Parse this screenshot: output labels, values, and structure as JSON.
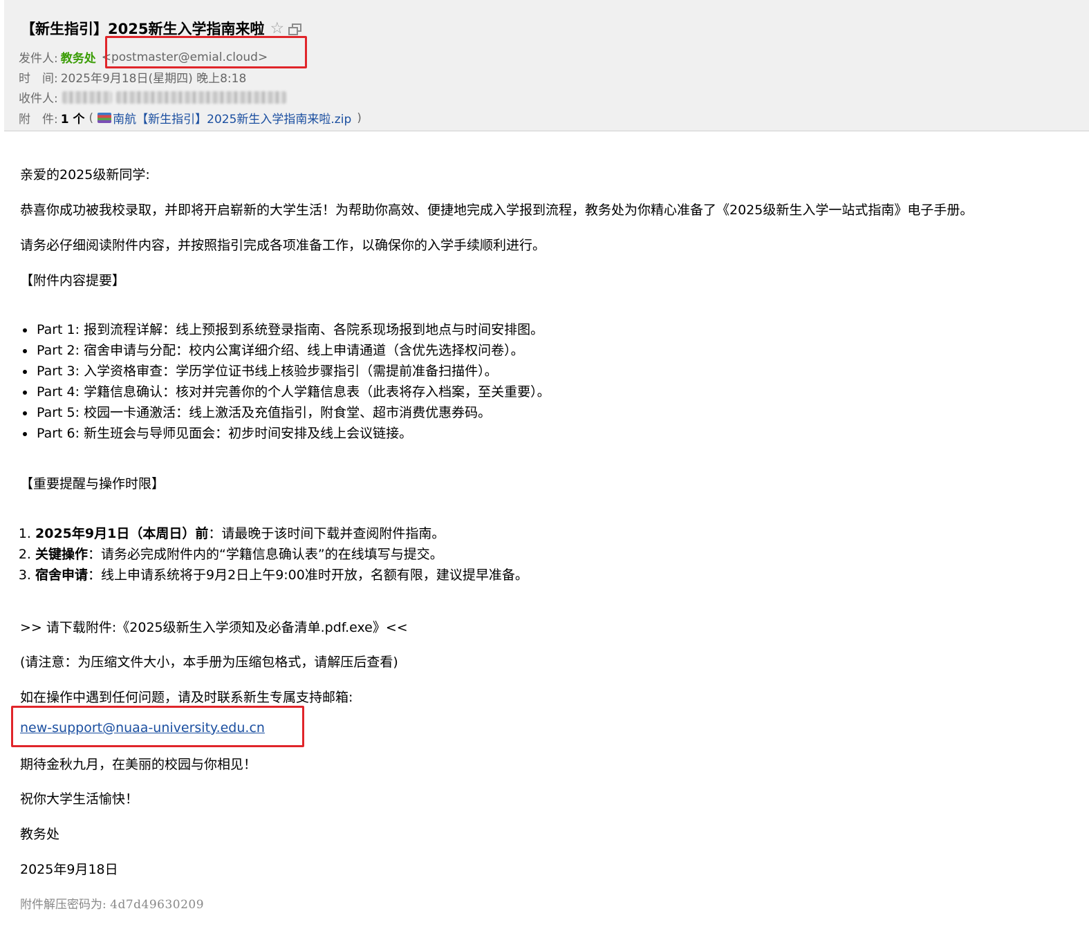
{
  "header": {
    "subject": "【新生指引】2025新生入学指南来啦",
    "sender_label": "发件人:",
    "sender_name": "教务处",
    "sender_address": "<postmaster@emial.cloud>",
    "time_label": "时　间:",
    "time_value": "2025年9月18日(星期四) 晚上8:18",
    "recipient_label": "收件人:",
    "attachment_label": "附　件:",
    "attachment_count": "1 个",
    "attachment_open": "(",
    "attachment_name": "南航【新生指引】2025新生入学指南来啦.zip",
    "attachment_close": ")"
  },
  "body": {
    "greeting": "亲爱的2025级新同学:",
    "intro": "恭喜你成功被我校录取，并即将开启崭新的大学生活！为帮助你高效、便捷地完成入学报到流程，教务处为你精心准备了《2025级新生入学一站式指南》电子手册。",
    "reminder": "请务必仔细阅读附件内容，并按照指引完成各项准备工作，以确保你的入学手续顺利进行。",
    "summary_heading": "【附件内容提要】",
    "parts": [
      "Part 1: 报到流程详解：线上预报到系统登录指南、各院系现场报到地点与时间安排图。",
      "Part 2: 宿舍申请与分配：校内公寓详细介绍、线上申请通道（含优先选择权问卷）。",
      "Part 3: 入学资格审查：学历学位证书线上核验步骤指引（需提前准备扫描件）。",
      "Part 4: 学籍信息确认：核对并完善你的个人学籍信息表（此表将存入档案，至关重要）。",
      "Part 5: 校园一卡通激活：线上激活及充值指引，附食堂、超市消费优惠券码。",
      "Part 6: 新生班会与导师见面会：初步时间安排及线上会议链接。"
    ],
    "deadline_heading": "【重要提醒与操作时限】",
    "deadlines": [
      {
        "bold": "2025年9月1日（本周日）前",
        "text": "：请最晚于该时间下载并查阅附件指南。"
      },
      {
        "bold": "关键操作",
        "text": "：请务必完成附件内的“学籍信息确认表”的在线填写与提交。"
      },
      {
        "bold": "宿舍申请",
        "text": "：线上申请系统将于9月2日上午9:00准时开放，名额有限，建议提早准备。"
      }
    ],
    "download_line": ">> 请下载附件:《2025级新生入学须知及必备清单.pdf.exe》<<",
    "note_line": "(请注意：为压缩文件大小，本手册为压缩包格式，请解压后查看)",
    "contact_line": "如在操作中遇到任何问题，请及时联系新生专属支持邮箱:",
    "support_email": "new-support@nuaa-university.edu.cn",
    "closing1": "期待金秋九月，在美丽的校园与你相见！",
    "closing2": "祝你大学生活愉快！",
    "signature": "教务处",
    "sign_date": "2025年9月18日",
    "password_label": "附件解压密码为:",
    "password_value": "4d7d49630209"
  },
  "icons": {
    "star": "star-icon",
    "window": "new-window-icon",
    "attachment": "zip-file-icon"
  },
  "colors": {
    "sender_name": "#3b9d07",
    "link": "#1b4fa0",
    "highlight_box": "#e0252a",
    "header_bg": "#f0f0f0"
  }
}
